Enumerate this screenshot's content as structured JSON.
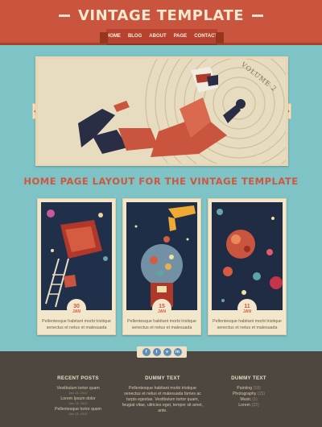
{
  "header": {
    "logo": "VINTAGE TEMPLATE",
    "nav": [
      "HOME",
      "BLOG",
      "ABOUT",
      "PAGE",
      "CONTACT"
    ]
  },
  "hero": {
    "caption": "VOLUME 2",
    "prev_arrow": "◆",
    "next_arrow": "◆"
  },
  "section_title": "HOME PAGE LAYOUT FOR THE VINTAGE TEMPLATE",
  "cards": [
    {
      "day": "30",
      "month": "JAN",
      "text": "Pellentesque habitant morbi tristique senectus et netus et malesuada"
    },
    {
      "day": "15",
      "month": "JAN",
      "text": "Pellentesque habitant morbi tristique senectus et netus et malesuada"
    },
    {
      "day": "11",
      "month": "JAN",
      "text": "Pellentesque habitant morbi tristique senectus et netus et malesuada"
    }
  ],
  "social": [
    "f",
    "t",
    "v",
    "in"
  ],
  "footer": {
    "recent_posts": {
      "heading": "RECENT POSTS",
      "items": [
        {
          "title": "Vestibulum tortor quam",
          "date": "Jan 13, 2012"
        },
        {
          "title": "Lorem Ipsum dolor",
          "date": "Jan 13, 2012"
        },
        {
          "title": "Pellentesque tortor quam",
          "date": "Jan 13, 2012"
        }
      ]
    },
    "dummy_text": {
      "heading": "DUMMY TEXT",
      "body": "Pellentesque habitant morbi tristique senectus et netus et malesuada fames ac turpis egestas. Vestibulum tortor quam, feugiat vitae, ultricies eget, tempor sit amet, ante."
    },
    "categories": {
      "heading": "DUMMY TEXT",
      "items": [
        {
          "name": "Painting",
          "count": "(18)"
        },
        {
          "name": "Photography",
          "count": "(15)"
        },
        {
          "name": "Music",
          "count": "(1)"
        },
        {
          "name": "Lorem",
          "count": "(22)"
        }
      ]
    }
  },
  "colors": {
    "background": "#7ec3c6",
    "header": "#c9553f",
    "accent": "#d0563d",
    "card": "#f3e7cb",
    "footer": "#4d4740"
  }
}
